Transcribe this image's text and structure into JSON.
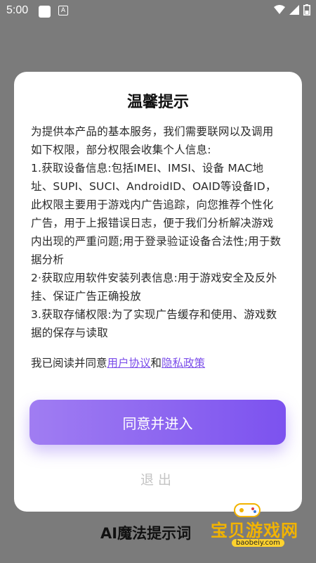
{
  "status": {
    "time": "5:00",
    "a_badge": "A"
  },
  "dialog": {
    "title": "温馨提示",
    "body": [
      "为提供本产品的基本服务，我们需要联网以及调用如下权限，部分权限会收集个人信息:",
      " 1.获取设备信息:包括IMEI、IMSI、设备 MAC地址、SUPI、SUCI、AndroidID、OAID等设备ID，此权限主要用于游戏内广告追踪，向您推荐个性化广告，用于上报错误日志，便于我们分析解决游戏内出现的严重问题;用于登录验证设备合法性;用于数据分析",
      " 2·获取应用软件安装列表信息:用于游戏安全及反外挂、保证广告正确投放",
      " 3.获取存储权限:为了实现广告缓存和使用、游戏数据的保存与读取"
    ],
    "agree_prefix": "我已阅读并同意",
    "user_agreement": "用户协议",
    "and": "和",
    "privacy_policy": "隐私政策",
    "agree_button": "同意并进入",
    "exit_button": "退出"
  },
  "background_title": "AI魔法提示词",
  "watermark": {
    "title": "宝贝游戏网",
    "url": "baobeiy.com"
  },
  "colors": {
    "accent": "#7c52ef",
    "link": "#7b4dea"
  }
}
